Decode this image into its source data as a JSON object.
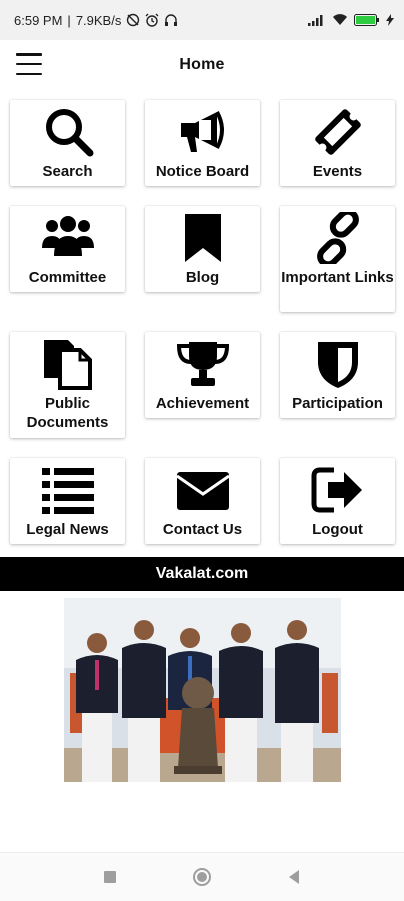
{
  "status_bar": {
    "time": "6:59 PM",
    "speed": "7.9KB/s",
    "icons": [
      "dnd-icon",
      "alarm-icon",
      "headset-icon",
      "signal-icon",
      "wifi-icon",
      "battery-icon",
      "charging-icon"
    ]
  },
  "appbar": {
    "title": "Home",
    "menu_icon": "hamburger-icon"
  },
  "tiles": [
    {
      "label": "Search",
      "icon": "search-icon"
    },
    {
      "label": "Notice Board",
      "icon": "megaphone-icon"
    },
    {
      "label": "Events",
      "icon": "ticket-icon"
    },
    {
      "label": "Committee",
      "icon": "users-icon"
    },
    {
      "label": "Blog",
      "icon": "bookmark-icon"
    },
    {
      "label": "Important Links",
      "icon": "link-icon"
    },
    {
      "label": "Public Documents",
      "icon": "documents-icon"
    },
    {
      "label": "Achievement",
      "icon": "trophy-icon"
    },
    {
      "label": "Participation",
      "icon": "shield-icon"
    },
    {
      "label": "Legal News",
      "icon": "list-icon"
    },
    {
      "label": "Contact Us",
      "icon": "envelope-icon"
    },
    {
      "label": "Logout",
      "icon": "logout-icon"
    }
  ],
  "footer": {
    "brand": "Vakalat.com"
  },
  "colors": {
    "accent": "#000000",
    "background": "#ffffff",
    "status_bar": "#f1f1f1",
    "battery": "#2ecc40"
  },
  "nav_bar": {
    "icons": [
      "recent-apps-icon",
      "home-icon",
      "back-icon"
    ]
  }
}
